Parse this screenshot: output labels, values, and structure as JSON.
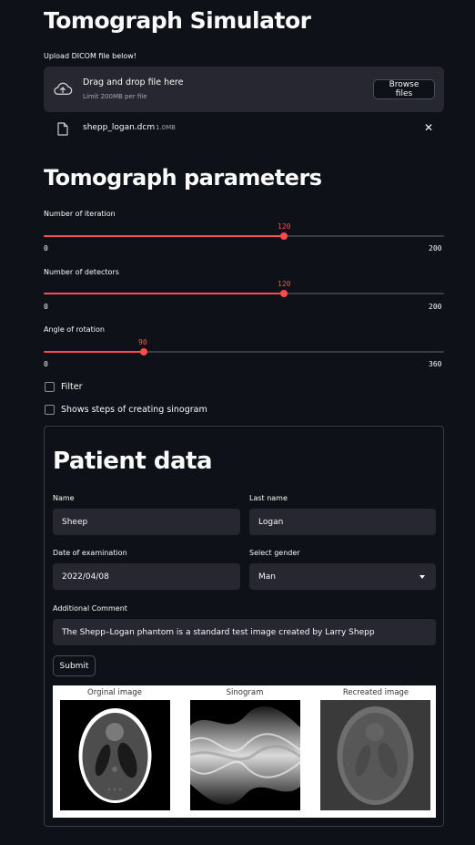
{
  "app": {
    "title": "Tomograph Simulator"
  },
  "upload": {
    "label": "Upload DICOM file below!",
    "drag_text": "Drag and drop file here",
    "limit_text": "Limit 200MB per file",
    "browse_label": "Browse files",
    "file": {
      "name": "shepp_logan.dcm",
      "size": "1.0MB"
    },
    "remove_symbol": "✕"
  },
  "params": {
    "heading": "Tomograph parameters",
    "sliders": [
      {
        "label": "Number of iteration",
        "value": "120",
        "min": "0",
        "max": "200"
      },
      {
        "label": "Number of detectors",
        "value": "120",
        "min": "0",
        "max": "200"
      },
      {
        "label": "Angle of rotation",
        "value": "90",
        "min": "0",
        "max": "360"
      }
    ],
    "checkboxes": [
      {
        "label": "Filter",
        "checked": false
      },
      {
        "label": "Shows steps of creating sinogram",
        "checked": false
      }
    ]
  },
  "patient": {
    "heading": "Patient data",
    "name_label": "Name",
    "name_value": "Sheep",
    "last_name_label": "Last name",
    "last_name_value": "Logan",
    "date_label": "Date of examination",
    "date_value": "2022/04/08",
    "gender_label": "Select gender",
    "gender_value": "Man",
    "comment_label": "Additional Comment",
    "comment_value": "The Shepp–Logan phantom is a standard test image created by Larry Shepp",
    "submit_label": "Submit"
  },
  "figure": {
    "panels": [
      "Orginal image",
      "Sinogram",
      "Recreated image"
    ]
  },
  "colors": {
    "accent": "#ff4b4b",
    "background": "#0e1117",
    "surface": "#262730"
  }
}
